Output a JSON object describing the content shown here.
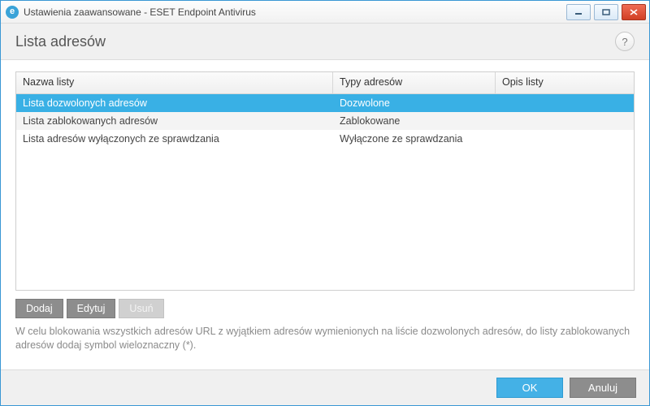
{
  "window": {
    "title": "Ustawienia zaawansowane - ESET Endpoint Antivirus",
    "icon_letter": "e"
  },
  "header": {
    "title": "Lista adresów",
    "help_symbol": "?"
  },
  "grid": {
    "columns": {
      "name": "Nazwa listy",
      "type": "Typy adresów",
      "desc": "Opis listy"
    },
    "rows": [
      {
        "name": "Lista dozwolonych adresów",
        "type": "Dozwolone",
        "desc": "",
        "selected": true
      },
      {
        "name": "Lista zablokowanych adresów",
        "type": "Zablokowane",
        "desc": "",
        "selected": false
      },
      {
        "name": "Lista adresów wyłączonych ze sprawdzania",
        "type": "Wyłączone ze sprawdzania",
        "desc": "",
        "selected": false
      }
    ]
  },
  "buttons": {
    "add": "Dodaj",
    "edit": "Edytuj",
    "delete": "Usuń"
  },
  "hint": "W celu blokowania wszystkich adresów URL z wyjątkiem adresów wymienionych na liście dozwolonych adresów, do listy zablokowanych adresów dodaj symbol wieloznaczny (*).",
  "footer": {
    "ok": "OK",
    "cancel": "Anuluj"
  }
}
